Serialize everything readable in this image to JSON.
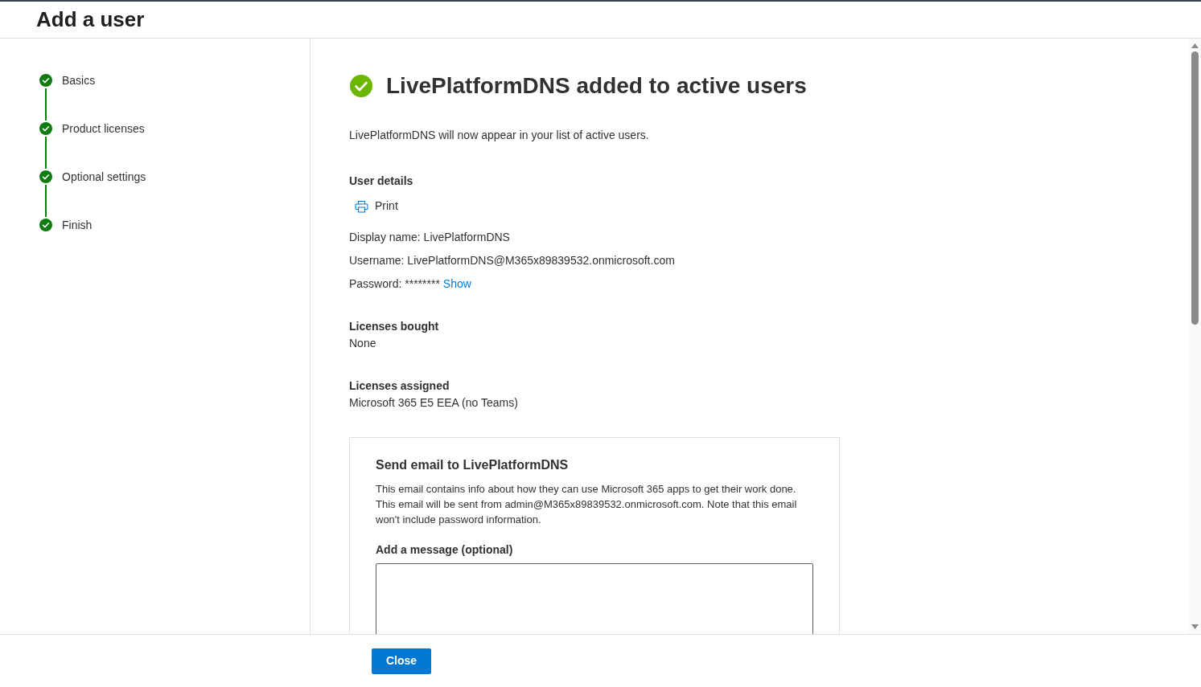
{
  "header": {
    "title": "Add a user"
  },
  "steps": [
    {
      "label": "Basics",
      "completed": true
    },
    {
      "label": "Product licenses",
      "completed": true
    },
    {
      "label": "Optional settings",
      "completed": true
    },
    {
      "label": "Finish",
      "completed": true
    }
  ],
  "main": {
    "heading": "LivePlatformDNS added to active users",
    "intro": "LivePlatformDNS will now appear in your list of active users.",
    "user_details": {
      "title": "User details",
      "print_label": "Print",
      "display_name": "Display name: LivePlatformDNS",
      "username": "Username: LivePlatformDNS@M365x89839532.onmicrosoft.com",
      "password": "Password: ********",
      "show_link": "Show"
    },
    "sections": [
      {
        "title": "Licenses bought",
        "value": "None"
      },
      {
        "title": "Licenses assigned",
        "value": "Microsoft 365 E5 EEA (no Teams)"
      }
    ],
    "email_card": {
      "title": "Send email to LivePlatformDNS",
      "body": "This email contains info about how they can use Microsoft 365 apps to get their work done. This email will be sent from admin@M365x89839532.onmicrosoft.com. Note that this email won't include password information.",
      "message_label": "Add a message (optional)"
    }
  },
  "footer": {
    "close_button": "Close"
  }
}
